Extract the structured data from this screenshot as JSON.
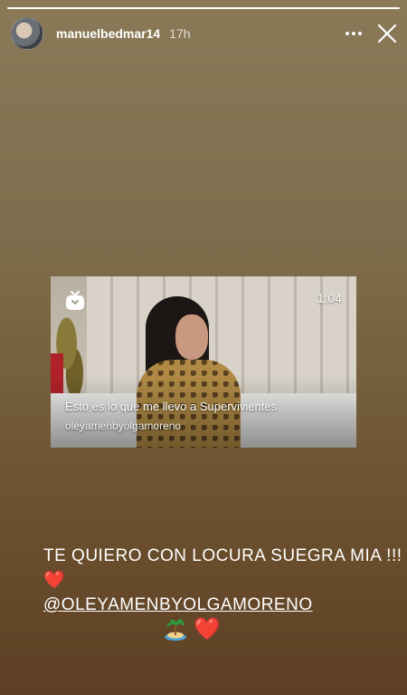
{
  "story": {
    "progress": 1.0,
    "username": "manuelbedmar14",
    "time": "17h"
  },
  "video": {
    "duration": "1:04",
    "title": "Esto es lo que me llevo a Supervivientes",
    "account": "oleyamenbyolgamoreno"
  },
  "caption": {
    "line1": "TE QUIERO CON LOCURA SUEGRA MIA !!!",
    "line1_emoji": "❤️",
    "mention": "@OLEYAMENBYOLGAMORENO",
    "emoji_row_heart": "❤️"
  },
  "icons": {
    "more": "more-horizontal-icon",
    "close": "close-icon",
    "igtv": "igtv-icon",
    "island": "island-icon"
  },
  "colors": {
    "heart": "#e02a36",
    "background_top": "#8a7a58",
    "background_bottom": "#5e3f24"
  }
}
